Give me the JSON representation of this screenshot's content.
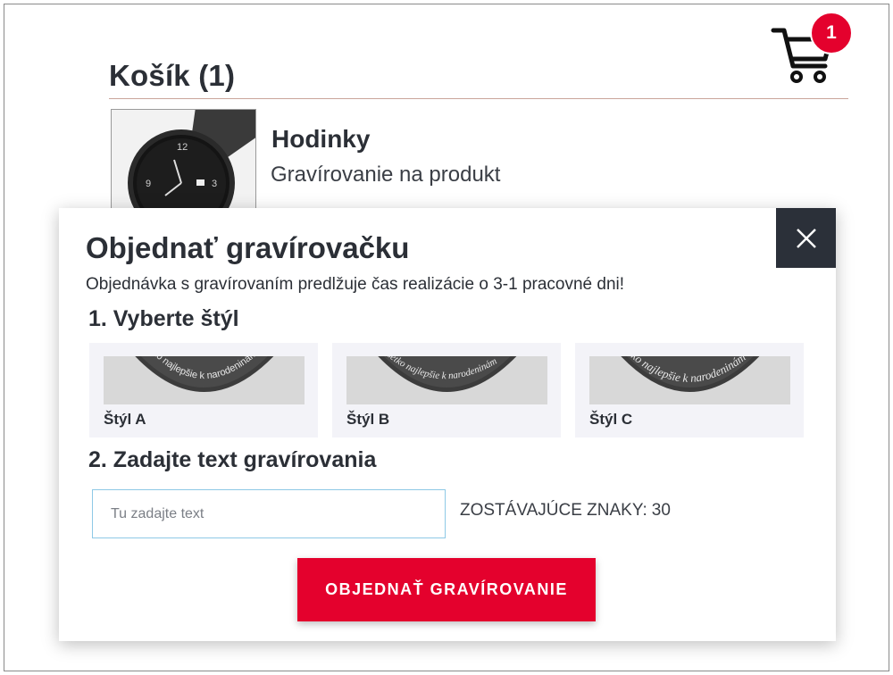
{
  "cart": {
    "title": "Košík (1)",
    "badge_count": "1"
  },
  "product": {
    "name": "Hodinky",
    "subtitle": "Gravírovanie na produkt"
  },
  "modal": {
    "title": "Objednať gravírovačku",
    "note": "Objednávka s gravírovaním predlžuje čas realizácie o 3-1 pracovné dni!",
    "step1_label": "1. Vyberte štýl",
    "step2_label": "2. Zadajte text gravírovania",
    "styles": [
      {
        "label": "Štýl A",
        "engraving": "Všetko najlepšie k narodeninám"
      },
      {
        "label": "Štýl B",
        "engraving": "Všetko najlepšie k narodeninám"
      },
      {
        "label": "Štýl C",
        "engraving": "Všetko najlepšie k narodeninám"
      }
    ],
    "input_placeholder": "Tu zadajte text",
    "remaining_label": "ZOSTÁVAJÚCE ZNAKY:",
    "remaining_count": "30",
    "order_button": "OBJEDNAŤ GRAVÍROVANIE",
    "close_icon": "close-icon"
  },
  "colors": {
    "accent_red": "#e4012d",
    "dark": "#2b3039",
    "input_border": "#8ec9e6"
  }
}
